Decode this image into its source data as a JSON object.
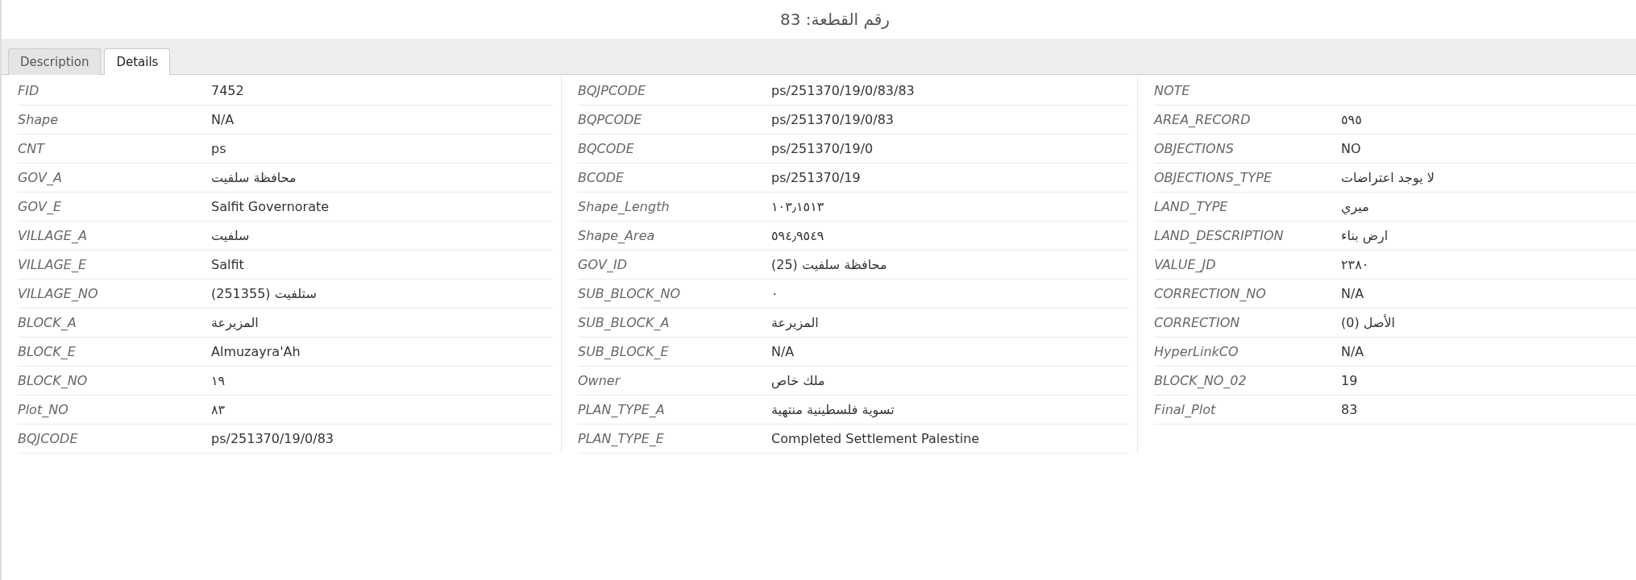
{
  "window": {
    "title": "رقم القطعة: 83"
  },
  "tabs": [
    {
      "label": "Description",
      "selected": false
    },
    {
      "label": "Details",
      "selected": true
    }
  ],
  "columns": [
    {
      "rows": [
        {
          "field": "FID",
          "value": "7452"
        },
        {
          "field": "Shape",
          "value": "N/A"
        },
        {
          "field": "CNT",
          "value": "ps"
        },
        {
          "field": "GOV_A",
          "value": "محافظة سلفيت"
        },
        {
          "field": "GOV_E",
          "value": "Salfit Governorate"
        },
        {
          "field": "VILLAGE_A",
          "value": "سلفيت"
        },
        {
          "field": "VILLAGE_E",
          "value": "Salfit"
        },
        {
          "field": "VILLAGE_NO",
          "value": "ستلفيت (251355)"
        },
        {
          "field": "BLOCK_A",
          "value": "المزيرعة"
        },
        {
          "field": "BLOCK_E",
          "value": "Almuzayra'Ah"
        },
        {
          "field": "BLOCK_NO",
          "value": "١٩"
        },
        {
          "field": "Plot_NO",
          "value": "٨٣"
        },
        {
          "field": "BQJCODE",
          "value": "ps/251370/19/0/83"
        }
      ]
    },
    {
      "rows": [
        {
          "field": "BQJPCODE",
          "value": "ps/251370/19/0/83/83"
        },
        {
          "field": "BQPCODE",
          "value": "ps/251370/19/0/83"
        },
        {
          "field": "BQCODE",
          "value": "ps/251370/19/0"
        },
        {
          "field": "BCODE",
          "value": "ps/251370/19"
        },
        {
          "field": "Shape_Length",
          "value": "١٠٣٫١٥١٣"
        },
        {
          "field": "Shape_Area",
          "value": "٥٩٤٫٩٥٤٩"
        },
        {
          "field": "GOV_ID",
          "value": "محافظة سلفيت (25)"
        },
        {
          "field": "SUB_BLOCK_NO",
          "value": "٠"
        },
        {
          "field": "SUB_BLOCK_A",
          "value": "المزيرعة"
        },
        {
          "field": "SUB_BLOCK_E",
          "value": "N/A"
        },
        {
          "field": "Owner",
          "value": "ملك خاص"
        },
        {
          "field": "PLAN_TYPE_A",
          "value": "تسوية فلسطينية منتهية"
        },
        {
          "field": "PLAN_TYPE_E",
          "value": "Completed Settlement Palestine"
        }
      ]
    },
    {
      "rows": [
        {
          "field": "NOTE"
        },
        {
          "field": "AREA_RECORD",
          "value": "٥٩٥"
        },
        {
          "field": "OBJECTIONS",
          "value": "NO"
        },
        {
          "field": "OBJECTIONS_TYPE",
          "value": "لا يوجد اعتراضات"
        },
        {
          "field": "LAND_TYPE",
          "value": "ميري"
        },
        {
          "field": "LAND_DESCRIPTION",
          "value": "ارض بناء"
        },
        {
          "field": "VALUE_JD",
          "value": "٢٣٨٠"
        },
        {
          "field": "CORRECTION_NO",
          "value": "N/A"
        },
        {
          "field": "CORRECTION",
          "value": "الأصل (0)"
        },
        {
          "field": "HyperLinkCO",
          "value": "N/A"
        },
        {
          "field": "BLOCK_NO_02",
          "value": "19"
        },
        {
          "field": "Final_Plot",
          "value": "83"
        }
      ]
    }
  ]
}
